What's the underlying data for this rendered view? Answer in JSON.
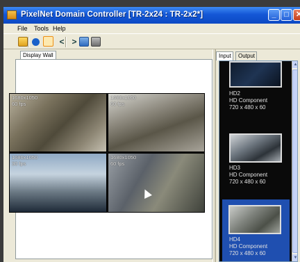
{
  "window": {
    "title": "PixelNet Domain Controller [TR-2x24 : TR-2x2*]",
    "caption_buttons": {
      "minimize": "_",
      "maximize": "□",
      "close": "✕"
    }
  },
  "menu": {
    "file": "File",
    "tools": "Tools",
    "help": "Help"
  },
  "toolbar": {
    "icons": [
      "open-folder-icon",
      "save-icon",
      "select-icon",
      "previous-icon",
      "next-icon",
      "grid-icon",
      "layout-icon"
    ],
    "prev_glyph": "<",
    "next_glyph": ">"
  },
  "left_pane": {
    "tab_label": "Display Wall",
    "tiles": [
      {
        "resolution": "1680x1050",
        "rate": "60 fps"
      },
      {
        "resolution": "1680x1050",
        "rate": "60 fps"
      },
      {
        "resolution": "1680x1050",
        "rate": "30 fps"
      },
      {
        "resolution": "1680x1050",
        "rate": "60 fps"
      }
    ]
  },
  "right_pane": {
    "tabs": [
      "Input",
      "Output"
    ],
    "sources": [
      {
        "name": "HD2",
        "type": "HD Component",
        "format": "720 x 480 x 60",
        "selected": false
      },
      {
        "name": "HD3",
        "type": "HD Component",
        "format": "720 x 480 x 60",
        "selected": false
      },
      {
        "name": "HD4",
        "type": "HD Component",
        "format": "720 x 480 x 60",
        "selected": true
      }
    ]
  },
  "colors": {
    "titlebar": "#1457d6",
    "selection": "#1f4fb0",
    "list_background": "#0a0a0a"
  }
}
